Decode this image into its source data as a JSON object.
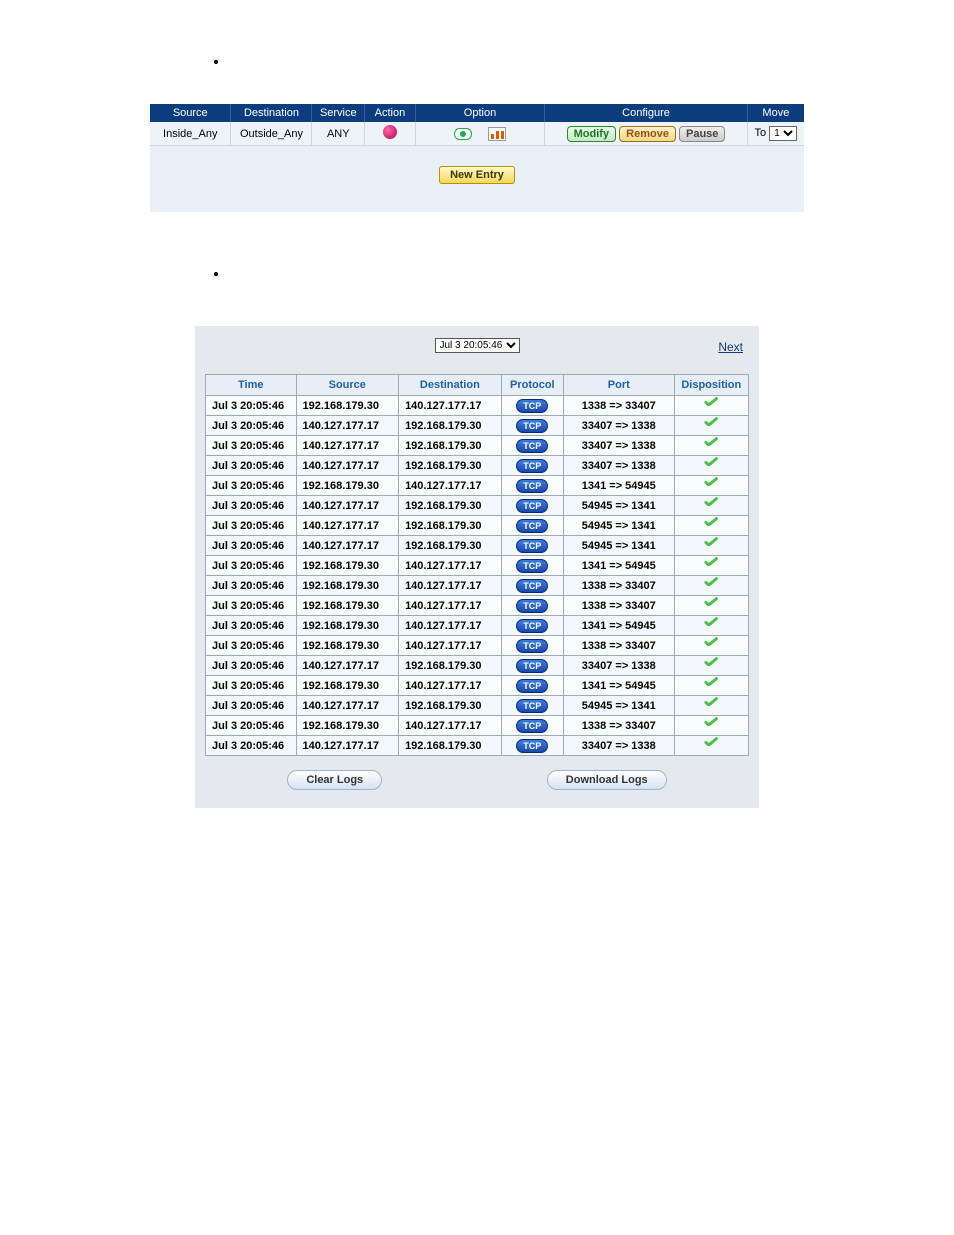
{
  "policy": {
    "headers": {
      "source": "Source",
      "destination": "Destination",
      "service": "Service",
      "action": "Action",
      "option": "Option",
      "configure": "Configure",
      "move": "Move"
    },
    "row": {
      "source": "Inside_Any",
      "destination": "Outside_Any",
      "service": "ANY",
      "move_label": "To",
      "move_value": "1"
    },
    "buttons": {
      "modify": "Modify",
      "remove": "Remove",
      "pause": "Pause",
      "new_entry": "New Entry"
    }
  },
  "log": {
    "date_selected": "Jul 3 20:05:46",
    "next_label": "Next",
    "headers": {
      "time": "Time",
      "source": "Source",
      "destination": "Destination",
      "protocol": "Protocol",
      "port": "Port",
      "disposition": "Disposition"
    },
    "protocol_label": "TCP",
    "buttons": {
      "clear": "Clear Logs",
      "download": "Download Logs"
    },
    "rows": [
      {
        "time": "Jul 3 20:05:46",
        "source": "192.168.179.30",
        "destination": "140.127.177.17",
        "port": "1338 => 33407"
      },
      {
        "time": "Jul 3 20:05:46",
        "source": "140.127.177.17",
        "destination": "192.168.179.30",
        "port": "33407 => 1338"
      },
      {
        "time": "Jul 3 20:05:46",
        "source": "140.127.177.17",
        "destination": "192.168.179.30",
        "port": "33407 => 1338"
      },
      {
        "time": "Jul 3 20:05:46",
        "source": "140.127.177.17",
        "destination": "192.168.179.30",
        "port": "33407 => 1338"
      },
      {
        "time": "Jul 3 20:05:46",
        "source": "192.168.179.30",
        "destination": "140.127.177.17",
        "port": "1341 => 54945"
      },
      {
        "time": "Jul 3 20:05:46",
        "source": "140.127.177.17",
        "destination": "192.168.179.30",
        "port": "54945 => 1341"
      },
      {
        "time": "Jul 3 20:05:46",
        "source": "140.127.177.17",
        "destination": "192.168.179.30",
        "port": "54945 => 1341"
      },
      {
        "time": "Jul 3 20:05:46",
        "source": "140.127.177.17",
        "destination": "192.168.179.30",
        "port": "54945 => 1341"
      },
      {
        "time": "Jul 3 20:05:46",
        "source": "192.168.179.30",
        "destination": "140.127.177.17",
        "port": "1341 => 54945"
      },
      {
        "time": "Jul 3 20:05:46",
        "source": "192.168.179.30",
        "destination": "140.127.177.17",
        "port": "1338 => 33407"
      },
      {
        "time": "Jul 3 20:05:46",
        "source": "192.168.179.30",
        "destination": "140.127.177.17",
        "port": "1338 => 33407"
      },
      {
        "time": "Jul 3 20:05:46",
        "source": "192.168.179.30",
        "destination": "140.127.177.17",
        "port": "1341 => 54945"
      },
      {
        "time": "Jul 3 20:05:46",
        "source": "192.168.179.30",
        "destination": "140.127.177.17",
        "port": "1338 => 33407"
      },
      {
        "time": "Jul 3 20:05:46",
        "source": "140.127.177.17",
        "destination": "192.168.179.30",
        "port": "33407 => 1338"
      },
      {
        "time": "Jul 3 20:05:46",
        "source": "192.168.179.30",
        "destination": "140.127.177.17",
        "port": "1341 => 54945"
      },
      {
        "time": "Jul 3 20:05:46",
        "source": "140.127.177.17",
        "destination": "192.168.179.30",
        "port": "54945 => 1341"
      },
      {
        "time": "Jul 3 20:05:46",
        "source": "192.168.179.30",
        "destination": "140.127.177.17",
        "port": "1338 => 33407"
      },
      {
        "time": "Jul 3 20:05:46",
        "source": "140.127.177.17",
        "destination": "192.168.179.30",
        "port": "33407 => 1338"
      }
    ]
  }
}
